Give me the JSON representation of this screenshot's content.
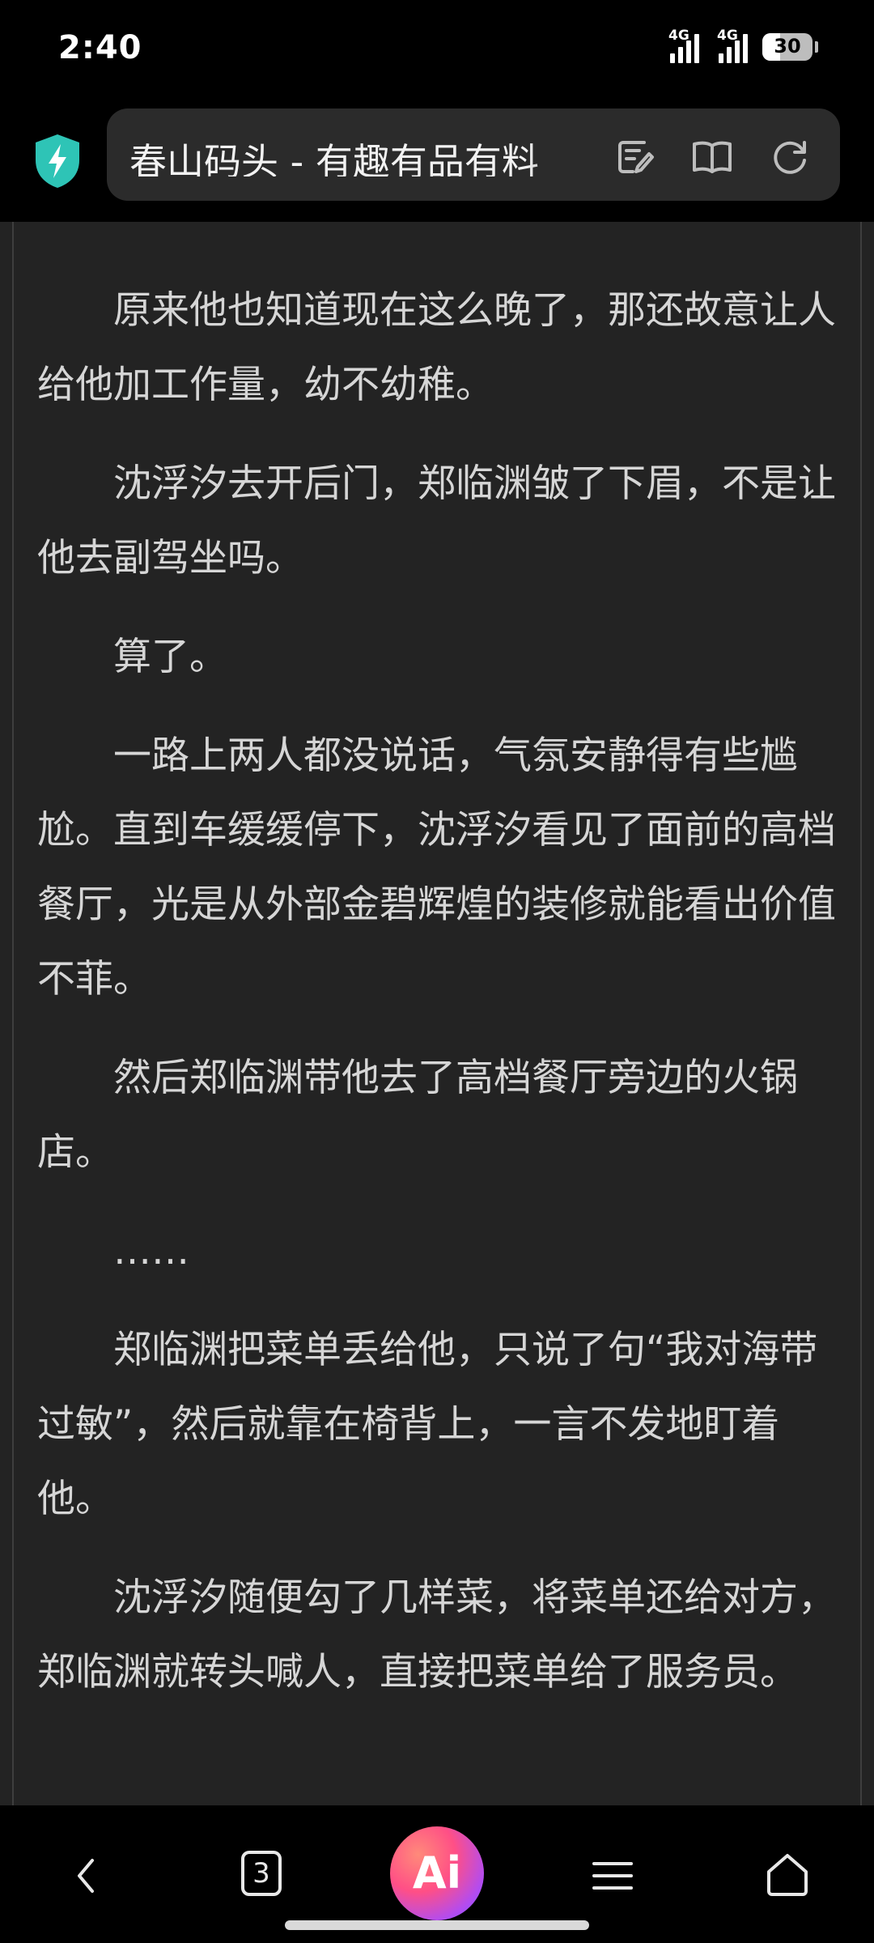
{
  "status_bar": {
    "time": "2:40",
    "network_1": "4G",
    "network_2": "4G",
    "battery": "30"
  },
  "browser": {
    "page_title": "春山码头 - 有趣有品有料",
    "icons": [
      "shield-icon",
      "edit-icon",
      "reader-mode-icon",
      "refresh-icon"
    ]
  },
  "article": {
    "paragraphs": [
      "原来他也知道现在这么晚了，那还故意让人给他加工作量，幼不幼稚。",
      "沈浮汐去开后门，郑临渊皱了下眉，不是让他去副驾坐吗。",
      "算了。",
      "一路上两人都没说话，气氛安静得有些尴尬。直到车缓缓停下，沈浮汐看见了面前的高档餐厅，光是从外部金碧辉煌的装修就能看出价值不菲。",
      "然后郑临渊带他去了高档餐厅旁边的火锅店。",
      "……",
      "郑临渊把菜单丢给他，只说了句“我对海带过敏”，然后就靠在椅背上，一言不发地盯着他。",
      "沈浮汐随便勾了几样菜，将菜单还给对方，郑临渊就转头喊人，直接把菜单给了服务员。"
    ]
  },
  "bottom_nav": {
    "tabs_count": "3",
    "ai_label": "Ai",
    "icons": [
      "back-icon",
      "tabs-icon",
      "ai-icon",
      "menu-icon",
      "home-icon"
    ]
  },
  "colors": {
    "background": "#000000",
    "reader_background": "#232323",
    "text": "#d6d6d6",
    "shield": "#2ec4b6"
  }
}
